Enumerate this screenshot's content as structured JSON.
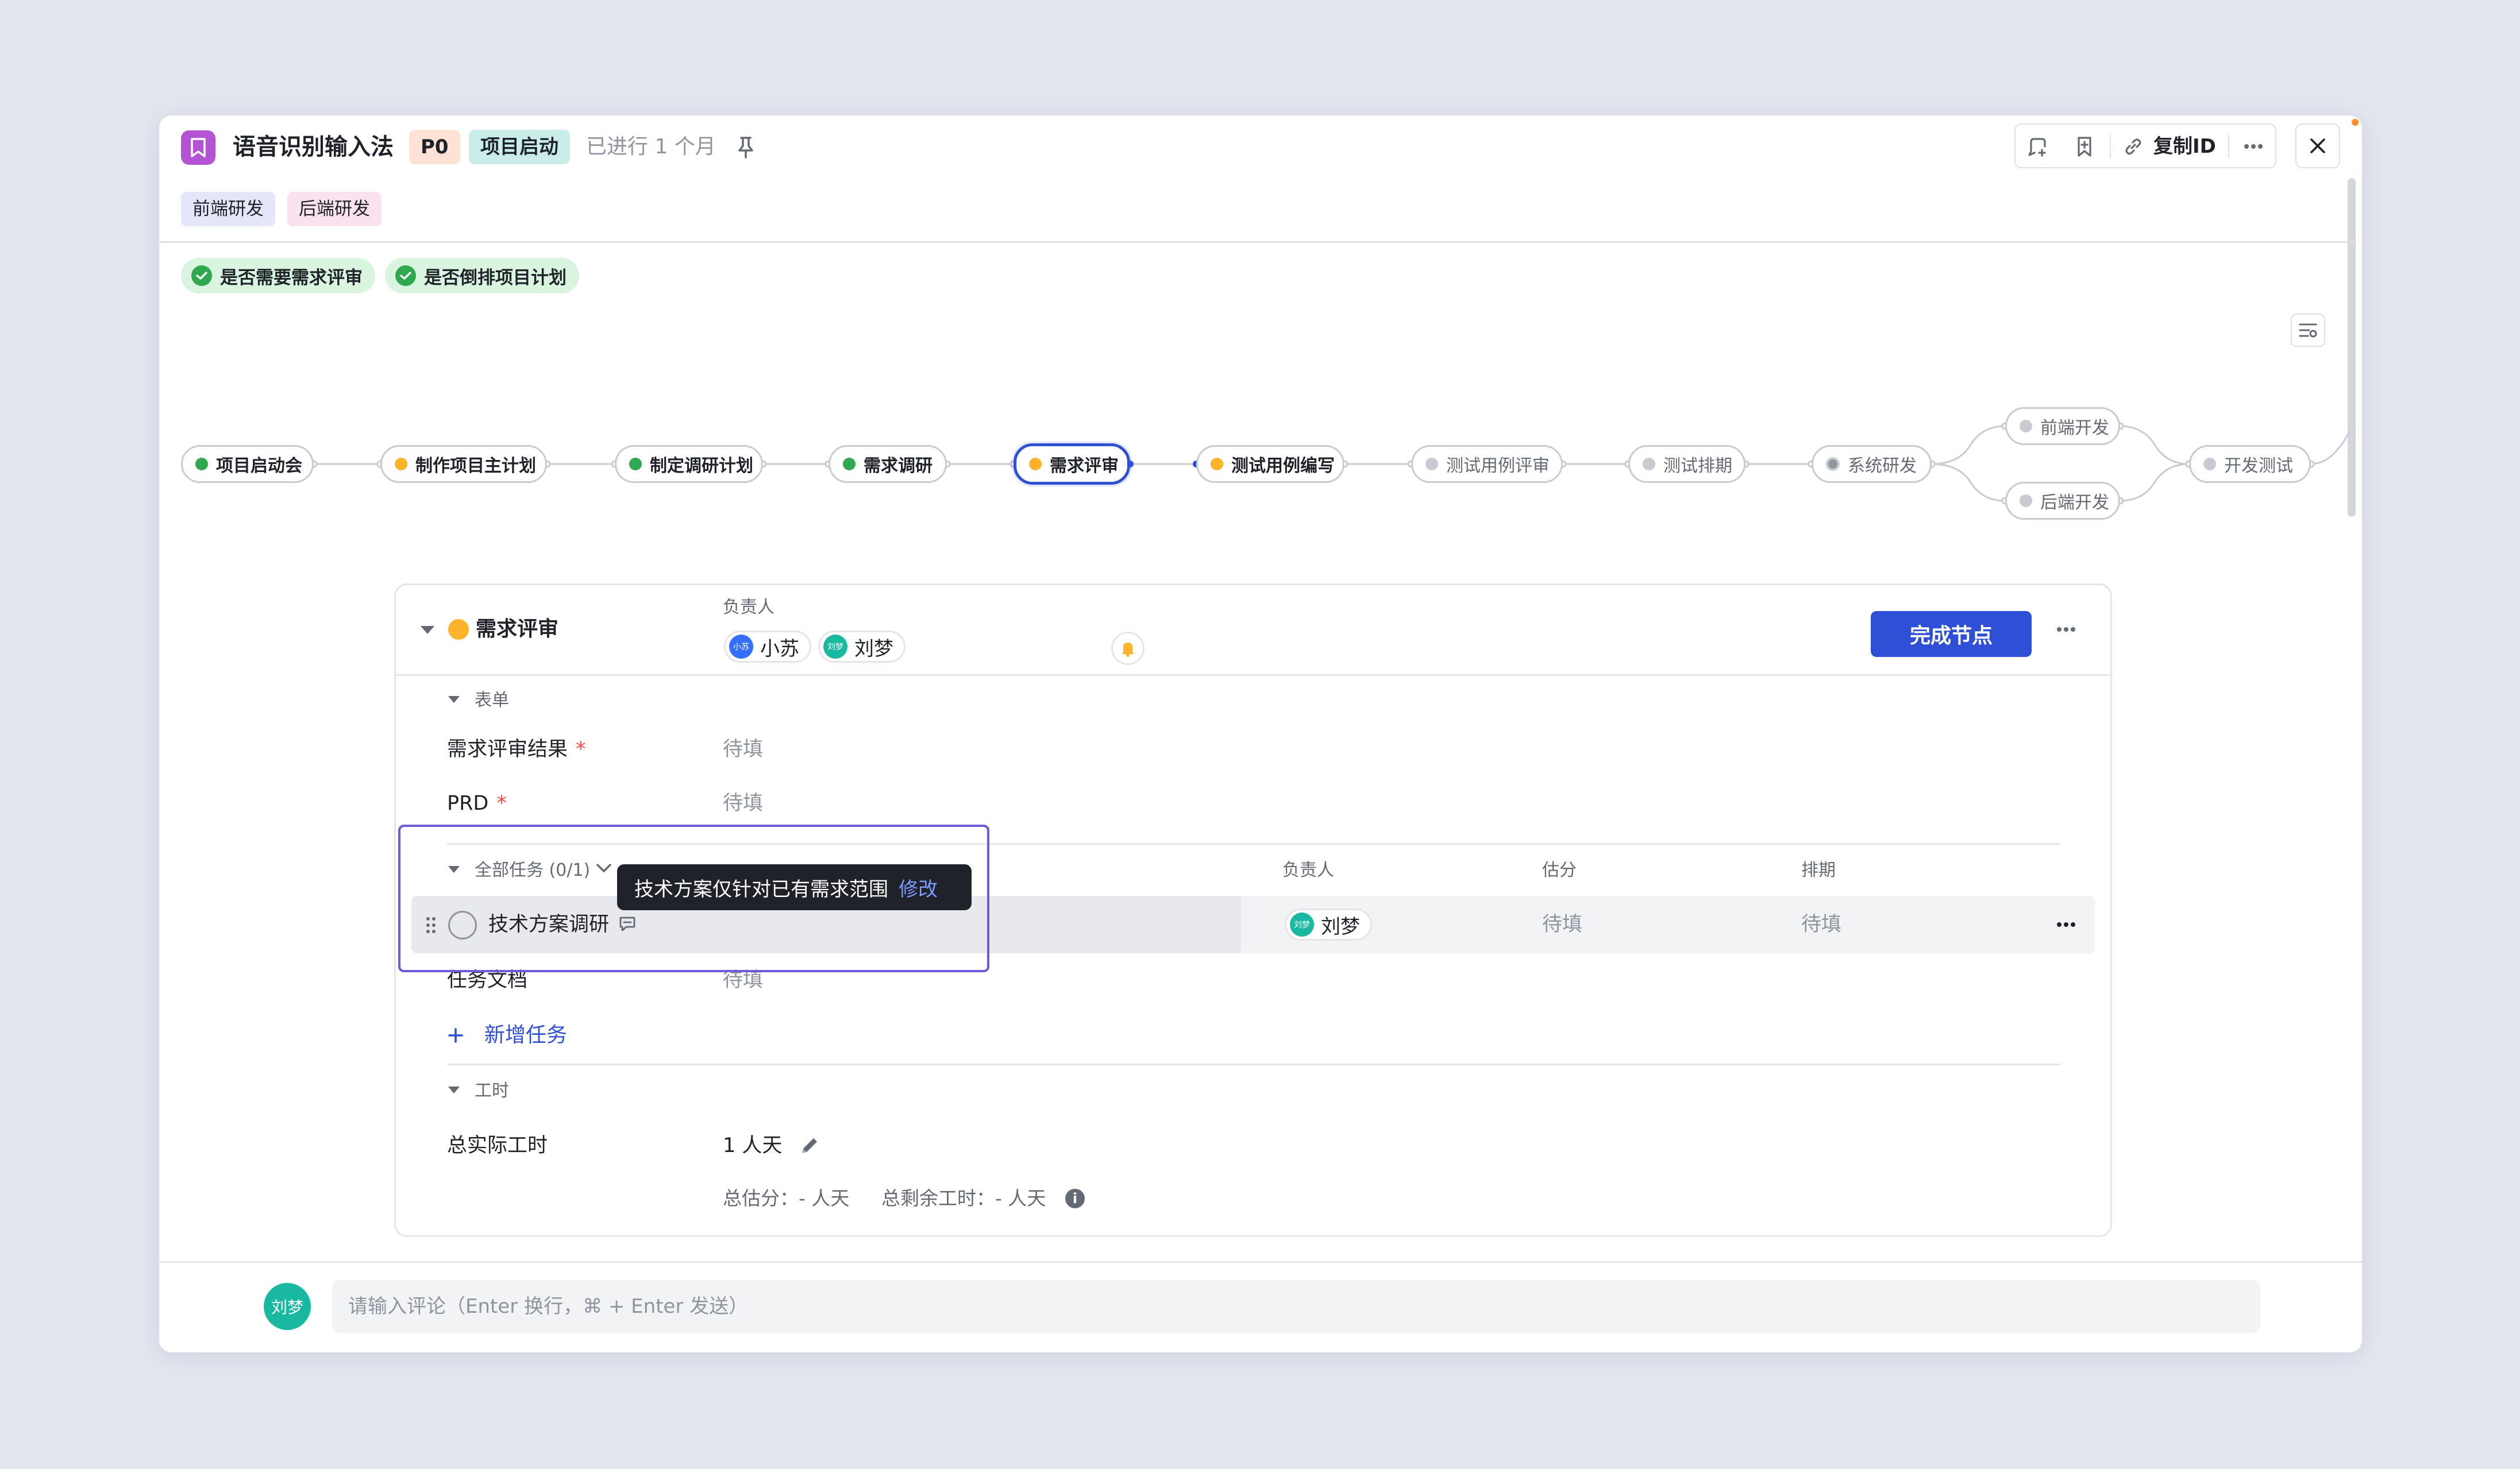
{
  "header": {
    "title": "语音识别输入法",
    "priority_tag": "P0",
    "stage_tag": "项目启动",
    "elapsed": "已进行 1 个月",
    "copy_id_label": "复制ID"
  },
  "team_tags": [
    "前端研发",
    "后端研发"
  ],
  "conditions": [
    "是否需要需求评审",
    "是否倒排项目计划"
  ],
  "flow": {
    "nodes": [
      {
        "label": "项目启动会",
        "status": "done"
      },
      {
        "label": "制作项目主计划",
        "status": "in-progress"
      },
      {
        "label": "制定调研计划",
        "status": "done"
      },
      {
        "label": "需求调研",
        "status": "done"
      },
      {
        "label": "需求评审",
        "status": "in-progress-active"
      },
      {
        "label": "测试用例编写",
        "status": "in-progress"
      },
      {
        "label": "测试用例评审",
        "status": "todo"
      },
      {
        "label": "测试排期",
        "status": "todo"
      },
      {
        "label": "系统研发",
        "status": "todo-system"
      },
      {
        "label": "前端开发",
        "status": "todo"
      },
      {
        "label": "后端开发",
        "status": "todo"
      },
      {
        "label": "开发测试",
        "status": "todo"
      }
    ]
  },
  "node_panel": {
    "title": "需求评审",
    "owner_label": "负责人",
    "owners": [
      {
        "name": "小苏",
        "avatar_text": "小苏"
      },
      {
        "name": "刘梦",
        "avatar_text": "刘梦"
      }
    ],
    "finish_button": "完成节点",
    "form_section": "表单",
    "form_fields": [
      {
        "label": "需求评审结果",
        "required": true,
        "value": "待填"
      },
      {
        "label": "PRD",
        "required": true,
        "value": "待填"
      }
    ],
    "tasks_section": "全部任务 (0/1)",
    "task_columns": {
      "owner": "负责人",
      "estimate": "估分",
      "schedule": "排期"
    },
    "tasks": [
      {
        "name": "技术方案调研",
        "owner": "刘梦",
        "owner_avatar": "刘梦",
        "estimate": "待填",
        "schedule": "待填"
      }
    ],
    "task_doc_label": "任务文档",
    "task_doc_value": "待填",
    "add_task": "新增任务",
    "hours_section": "工时",
    "total_actual_label": "总实际工时",
    "total_actual_value": "1 人天",
    "summary_estimate": "总估分：- 人天",
    "summary_remaining": "总剩余工时：- 人天"
  },
  "tooltip": {
    "text": "技术方案仅针对已有需求范围",
    "action": "修改"
  },
  "comment": {
    "avatar_text": "刘梦",
    "placeholder": "请输入评论（Enter 换行，⌘ + Enter 发送）"
  },
  "colors": {
    "accent": "#2f50d5",
    "done": "#2fa84f",
    "in_progress": "#ffb32a",
    "todo": "#c8cbd1",
    "highlight_border": "#6f5bd8"
  }
}
